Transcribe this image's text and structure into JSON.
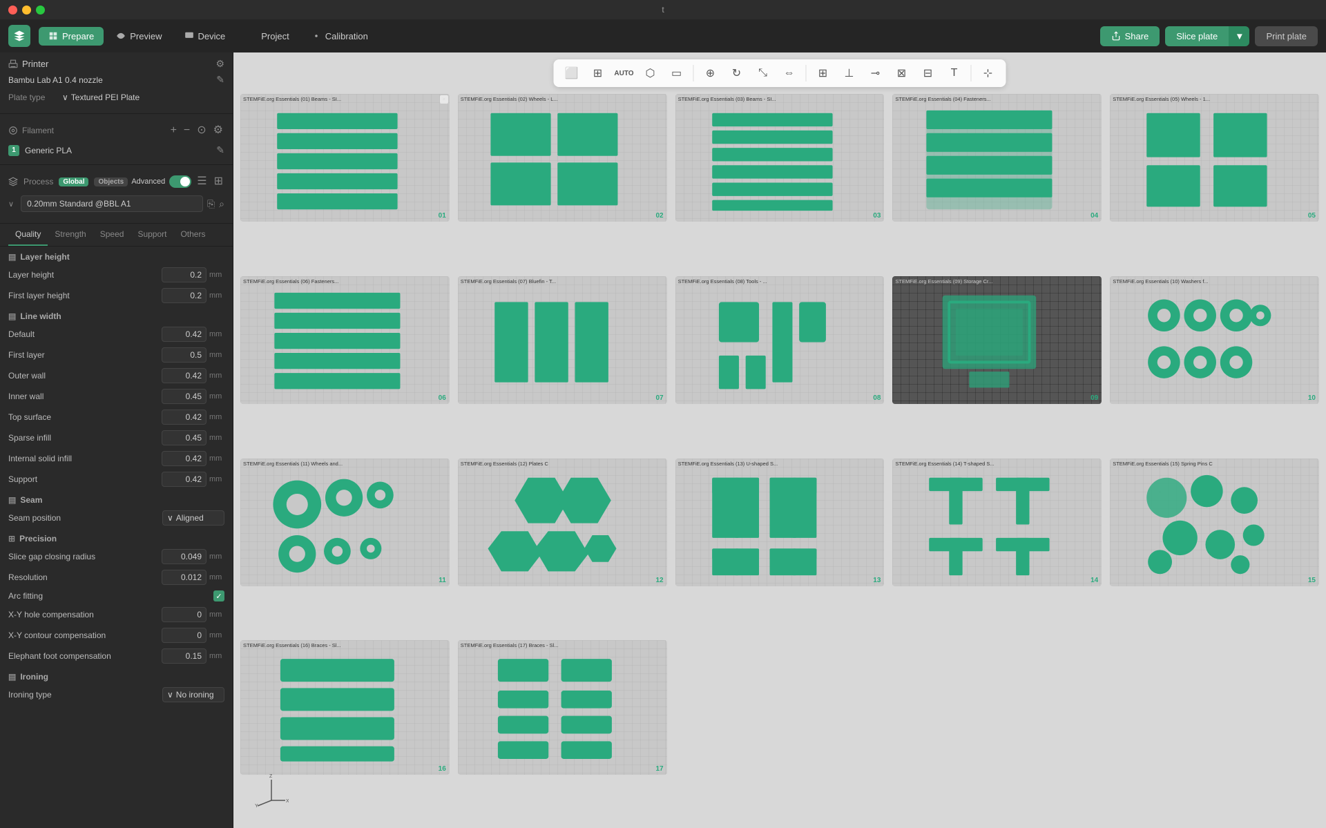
{
  "titlebar": {
    "title": "t"
  },
  "navbar": {
    "tabs": [
      {
        "id": "prepare",
        "label": "Prepare",
        "active": true
      },
      {
        "id": "preview",
        "label": "Preview",
        "active": false
      },
      {
        "id": "device",
        "label": "Device",
        "active": false
      },
      {
        "id": "project",
        "label": "Project",
        "active": false
      },
      {
        "id": "calibration",
        "label": "Calibration",
        "active": false
      }
    ],
    "share_label": "Share",
    "slice_label": "Slice plate",
    "print_label": "Print plate"
  },
  "sidebar": {
    "printer_section": "Printer",
    "printer_name": "Bambu Lab A1 0.4 nozzle",
    "plate_type_label": "Plate type",
    "plate_type_value": "Textured PEI Plate",
    "filament_section": "Filament",
    "filament_name": "Generic PLA",
    "filament_num": "1",
    "process_section": "Process",
    "process_global": "Global",
    "process_objects": "Objects",
    "process_advanced": "Advanced",
    "profile_name": "0.20mm Standard @BBL A1",
    "quality_tabs": [
      "Quality",
      "Strength",
      "Speed",
      "Support",
      "Others"
    ],
    "active_tab": "Quality",
    "settings": {
      "layer_height_group": "Layer height",
      "layer_height_label": "Layer height",
      "layer_height_value": "0.2",
      "layer_height_unit": "mm",
      "first_layer_height_label": "First layer height",
      "first_layer_height_value": "0.2",
      "first_layer_height_unit": "mm",
      "line_width_group": "Line width",
      "default_label": "Default",
      "default_value": "0.42",
      "default_unit": "mm",
      "first_layer_label": "First layer",
      "first_layer_value": "0.5",
      "first_layer_unit": "mm",
      "outer_wall_label": "Outer wall",
      "outer_wall_value": "0.42",
      "outer_wall_unit": "mm",
      "inner_wall_label": "Inner wall",
      "inner_wall_value": "0.45",
      "inner_wall_unit": "mm",
      "top_surface_label": "Top surface",
      "top_surface_value": "0.42",
      "top_surface_unit": "mm",
      "sparse_infill_label": "Sparse infill",
      "sparse_infill_value": "0.45",
      "sparse_infill_unit": "mm",
      "internal_solid_label": "Internal solid infill",
      "internal_solid_value": "0.42",
      "internal_solid_unit": "mm",
      "support_label": "Support",
      "support_value": "0.42",
      "support_unit": "mm",
      "seam_group": "Seam",
      "seam_position_label": "Seam position",
      "seam_position_value": "Aligned",
      "precision_group": "Precision",
      "slice_gap_label": "Slice gap closing radius",
      "slice_gap_value": "0.049",
      "slice_gap_unit": "mm",
      "resolution_label": "Resolution",
      "resolution_value": "0.012",
      "resolution_unit": "mm",
      "arc_fitting_label": "Arc fitting",
      "arc_fitting_checked": true,
      "xy_hole_label": "X-Y hole compensation",
      "xy_hole_value": "0",
      "xy_hole_unit": "mm",
      "xy_contour_label": "X-Y contour compensation",
      "xy_contour_value": "0",
      "xy_contour_unit": "mm",
      "elephant_label": "Elephant foot compensation",
      "elephant_value": "0.15",
      "elephant_unit": "mm",
      "ironing_group": "Ironing",
      "ironing_type_label": "Ironing type",
      "ironing_type_value": "No ironing"
    }
  },
  "plates": [
    {
      "id": 1,
      "title": "STEMFiE.org Essentials (01) Beams - SI...",
      "num": "01",
      "type": "grid"
    },
    {
      "id": 2,
      "title": "STEMFiE.org Essentials (02) Wheels - L...",
      "num": "02",
      "type": "grid"
    },
    {
      "id": 3,
      "title": "STEMFiE.org Essentials (03) Beams - SI...",
      "num": "03",
      "type": "grid"
    },
    {
      "id": 4,
      "title": "STEMFiE.org Essentials (04) Fastener...",
      "num": "04",
      "type": "grid"
    },
    {
      "id": 5,
      "title": "STEMFiE.org Essentials (05) Wheels - 1...",
      "num": "05",
      "type": "grid"
    },
    {
      "id": 6,
      "title": "STEMFiE.org Essentials (06) Fasteners...",
      "num": "06",
      "type": "grid"
    },
    {
      "id": 7,
      "title": "STEMFiE.org Essentials (07) Bluefin - T...",
      "num": "07",
      "type": "grid"
    },
    {
      "id": 8,
      "title": "STEMFiE.org Essentials (08) Tools - ...",
      "num": "08",
      "type": "grid"
    },
    {
      "id": 9,
      "title": "STEMFiE.org Essentials (09) Storage Cr...",
      "num": "09",
      "type": "dark"
    },
    {
      "id": 10,
      "title": "STEMFiE.org Essentials (10) Washers f...",
      "num": "10",
      "type": "grid"
    },
    {
      "id": 11,
      "title": "STEMFiE.org Essentials (11) Wheels and...",
      "num": "11",
      "type": "grid"
    },
    {
      "id": 12,
      "title": "STEMFiE.org Essentials (12) Plates C",
      "num": "12",
      "type": "grid"
    },
    {
      "id": 13,
      "title": "STEMFiE.org Essentials (13) U-shaped S...",
      "num": "13",
      "type": "grid"
    },
    {
      "id": 14,
      "title": "STEMFiE.org Essentials (14) T-shaped S...",
      "num": "14",
      "type": "grid"
    },
    {
      "id": 15,
      "title": "STEMFiE.org Essentials (15) Spring Pins C",
      "num": "15",
      "type": "grid"
    },
    {
      "id": 16,
      "title": "STEMFiE.org Essentials (16) Braces - Sl...",
      "num": "16",
      "type": "grid"
    },
    {
      "id": 17,
      "title": "STEMFiE.org Essentials (17) Braces - Sl...",
      "num": "17",
      "type": "grid"
    }
  ]
}
